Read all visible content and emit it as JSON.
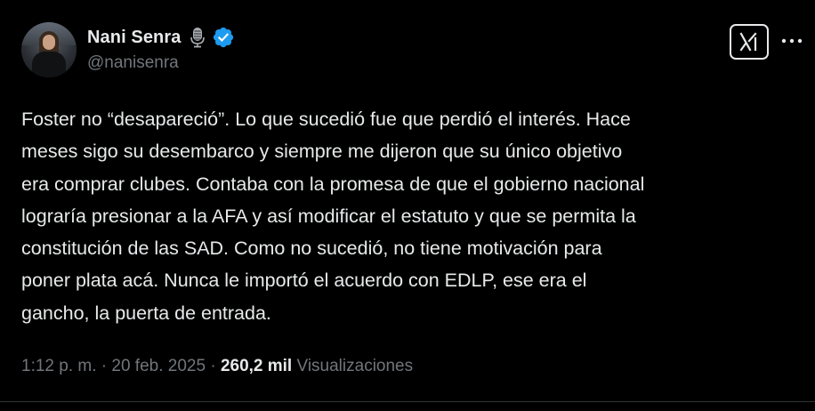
{
  "author": {
    "display_name": "Nani Senra",
    "handle": "@nanisenra",
    "badges": [
      "microphone-icon",
      "verified-badge-icon"
    ],
    "verified_color": "#1d9bf0"
  },
  "actions": {
    "grok_icon": "grok-icon",
    "more_icon": "more-horizontal-icon"
  },
  "tweet": {
    "lines": [
      "Foster no “desapareció”. Lo que sucedió fue que perdió el interés. Hace",
      "meses sigo su desembarco y siempre me dijeron que su único objetivo",
      "era comprar clubes. Contaba con la promesa de que el gobierno nacional",
      "lograría presionar a la AFA y así modificar el estatuto y que se permita la",
      "constitución de las SAD. Como no sucedió, no tiene motivación para",
      "poner plata acá. Nunca le importó el acuerdo con EDLP, ese era el",
      "gancho, la puerta de entrada."
    ]
  },
  "meta": {
    "time": "1:12 p. m.",
    "separator": " · ",
    "date": "20 feb. 2025",
    "views_count": "260,2 mil",
    "views_label": "Visualizaciones"
  },
  "colors": {
    "background": "#000000",
    "text": "#e7e9ea",
    "secondary": "#71767b",
    "divider": "#2f3336"
  }
}
